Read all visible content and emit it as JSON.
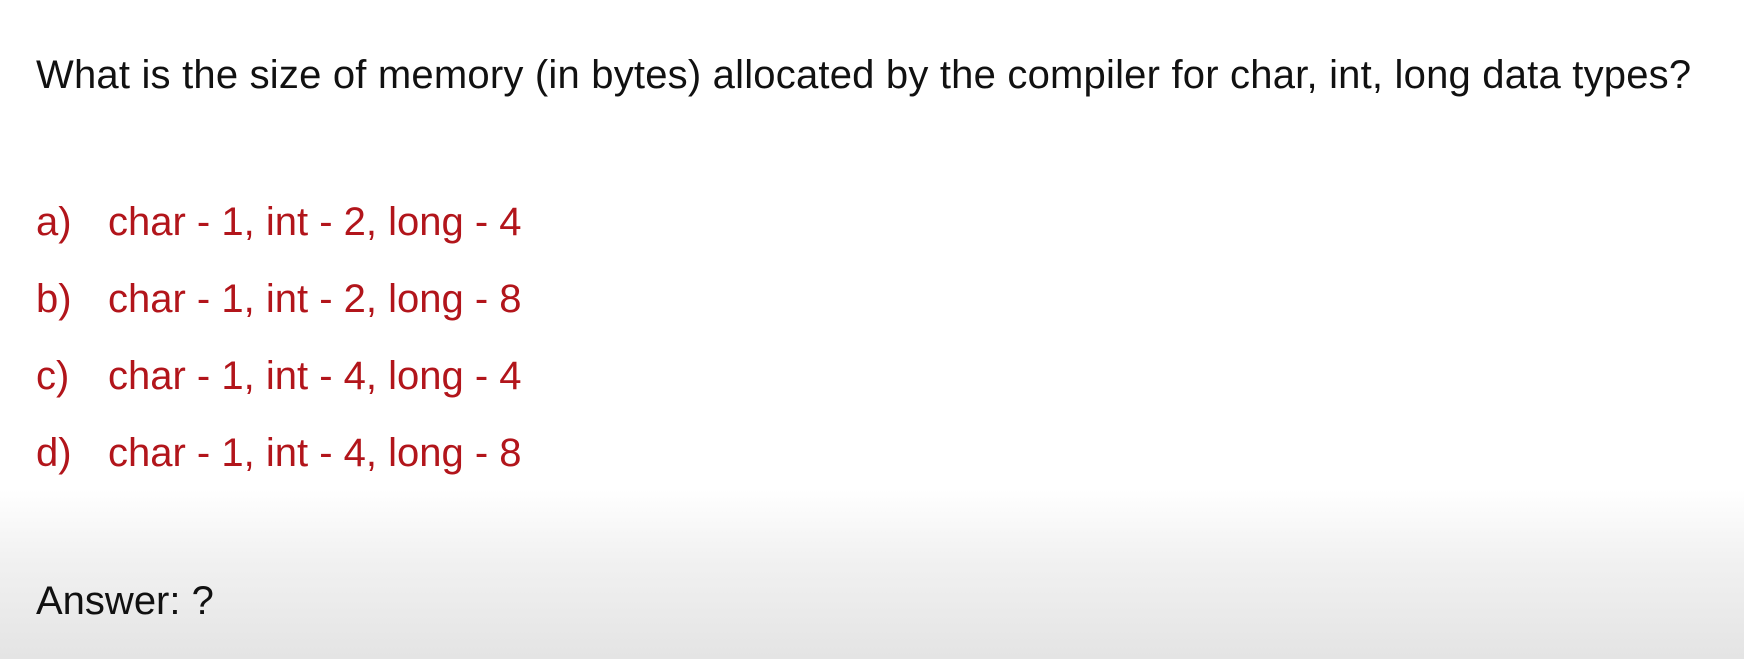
{
  "question": {
    "text": "What is the size of memory (in bytes) allocated by the compiler for char, int, long data types?"
  },
  "options": [
    {
      "letter": "a)",
      "text": "char - 1, int - 2, long - 4"
    },
    {
      "letter": "b)",
      "text": "char - 1, int - 2, long - 8"
    },
    {
      "letter": "c)",
      "text": "char - 1, int - 4, long - 4"
    },
    {
      "letter": "d)",
      "text": "char - 1, int - 4, long - 8"
    }
  ],
  "answer": {
    "text": "Answer: ?"
  },
  "colors": {
    "question_text": "#111111",
    "option_text": "#b2151b",
    "background": "#ffffff",
    "footer_gradient": "#e4e4e4"
  }
}
